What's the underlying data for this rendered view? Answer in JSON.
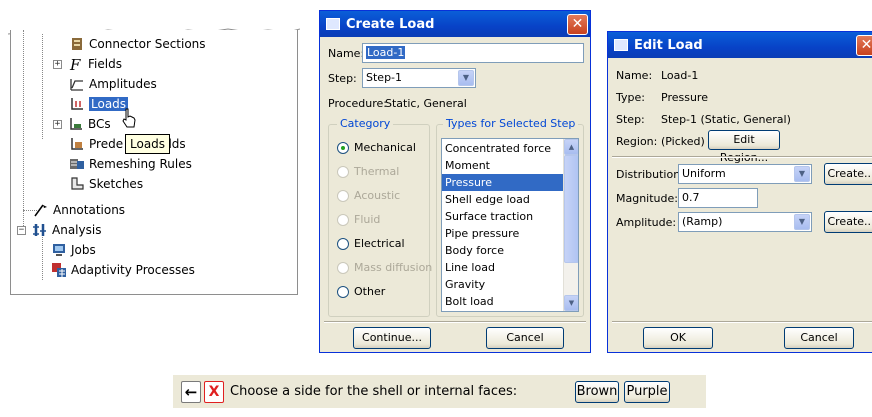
{
  "tree": {
    "items": [
      {
        "label": "Connector Sections"
      },
      {
        "label": "Fields",
        "expander": "+"
      },
      {
        "label": "Amplitudes"
      },
      {
        "label": "Loads"
      },
      {
        "label": "BCs",
        "expander": "+"
      },
      {
        "label": "Prede",
        "suffix": "elds"
      },
      {
        "label": "Remeshing Rules"
      },
      {
        "label": "Sketches"
      },
      {
        "label": "Annotations"
      },
      {
        "label": "Analysis",
        "expander": "−"
      },
      {
        "label": "Jobs"
      },
      {
        "label": "Adaptivity Processes"
      }
    ],
    "tooltip": "Loads"
  },
  "create_load": {
    "title": "Create Load",
    "name_label": "Name:",
    "name_value": "Load-1",
    "step_label": "Step:",
    "step_value": "Step-1",
    "procedure_label": "Procedure:",
    "procedure_value": "Static, General",
    "category_title": "Category",
    "categories": [
      {
        "label": "Mechanical",
        "state": "selected"
      },
      {
        "label": "Thermal",
        "state": "disabled"
      },
      {
        "label": "Acoustic",
        "state": "disabled"
      },
      {
        "label": "Fluid",
        "state": "disabled"
      },
      {
        "label": "Electrical",
        "state": "enabled"
      },
      {
        "label": "Mass diffusion",
        "state": "disabled"
      },
      {
        "label": "Other",
        "state": "enabled"
      }
    ],
    "types_title": "Types for Selected Step",
    "types": [
      "Concentrated force",
      "Moment",
      "Pressure",
      "Shell edge load",
      "Surface traction",
      "Pipe pressure",
      "Body force",
      "Line load",
      "Gravity",
      "Bolt load"
    ],
    "selected_type": "Pressure",
    "continue_label": "Continue...",
    "cancel_label": "Cancel"
  },
  "edit_load": {
    "title": "Edit Load",
    "name_label": "Name:",
    "name_value": "Load-1",
    "type_label": "Type:",
    "type_value": "Pressure",
    "step_label": "Step:",
    "step_value": "Step-1 (Static, General)",
    "region_label": "Region:",
    "region_value": "(Picked)",
    "edit_region_label": "Edit Region...",
    "distribution_label": "Distribution:",
    "distribution_value": "Uniform",
    "magnitude_label": "Magnitude:",
    "magnitude_value": "0.7",
    "amplitude_label": "Amplitude:",
    "amplitude_value": "(Ramp)",
    "create_label": "Create...",
    "ok_label": "OK",
    "cancel_label": "Cancel"
  },
  "prompt": {
    "text": "Choose a side for the shell or internal faces:",
    "brown_label": "Brown",
    "purple_label": "Purple",
    "back_glyph": "←",
    "cancel_glyph": "X"
  },
  "colors": {
    "titlebar": "#0842c7",
    "selection": "#316ac5",
    "dialog_bg": "#ece9d8"
  }
}
